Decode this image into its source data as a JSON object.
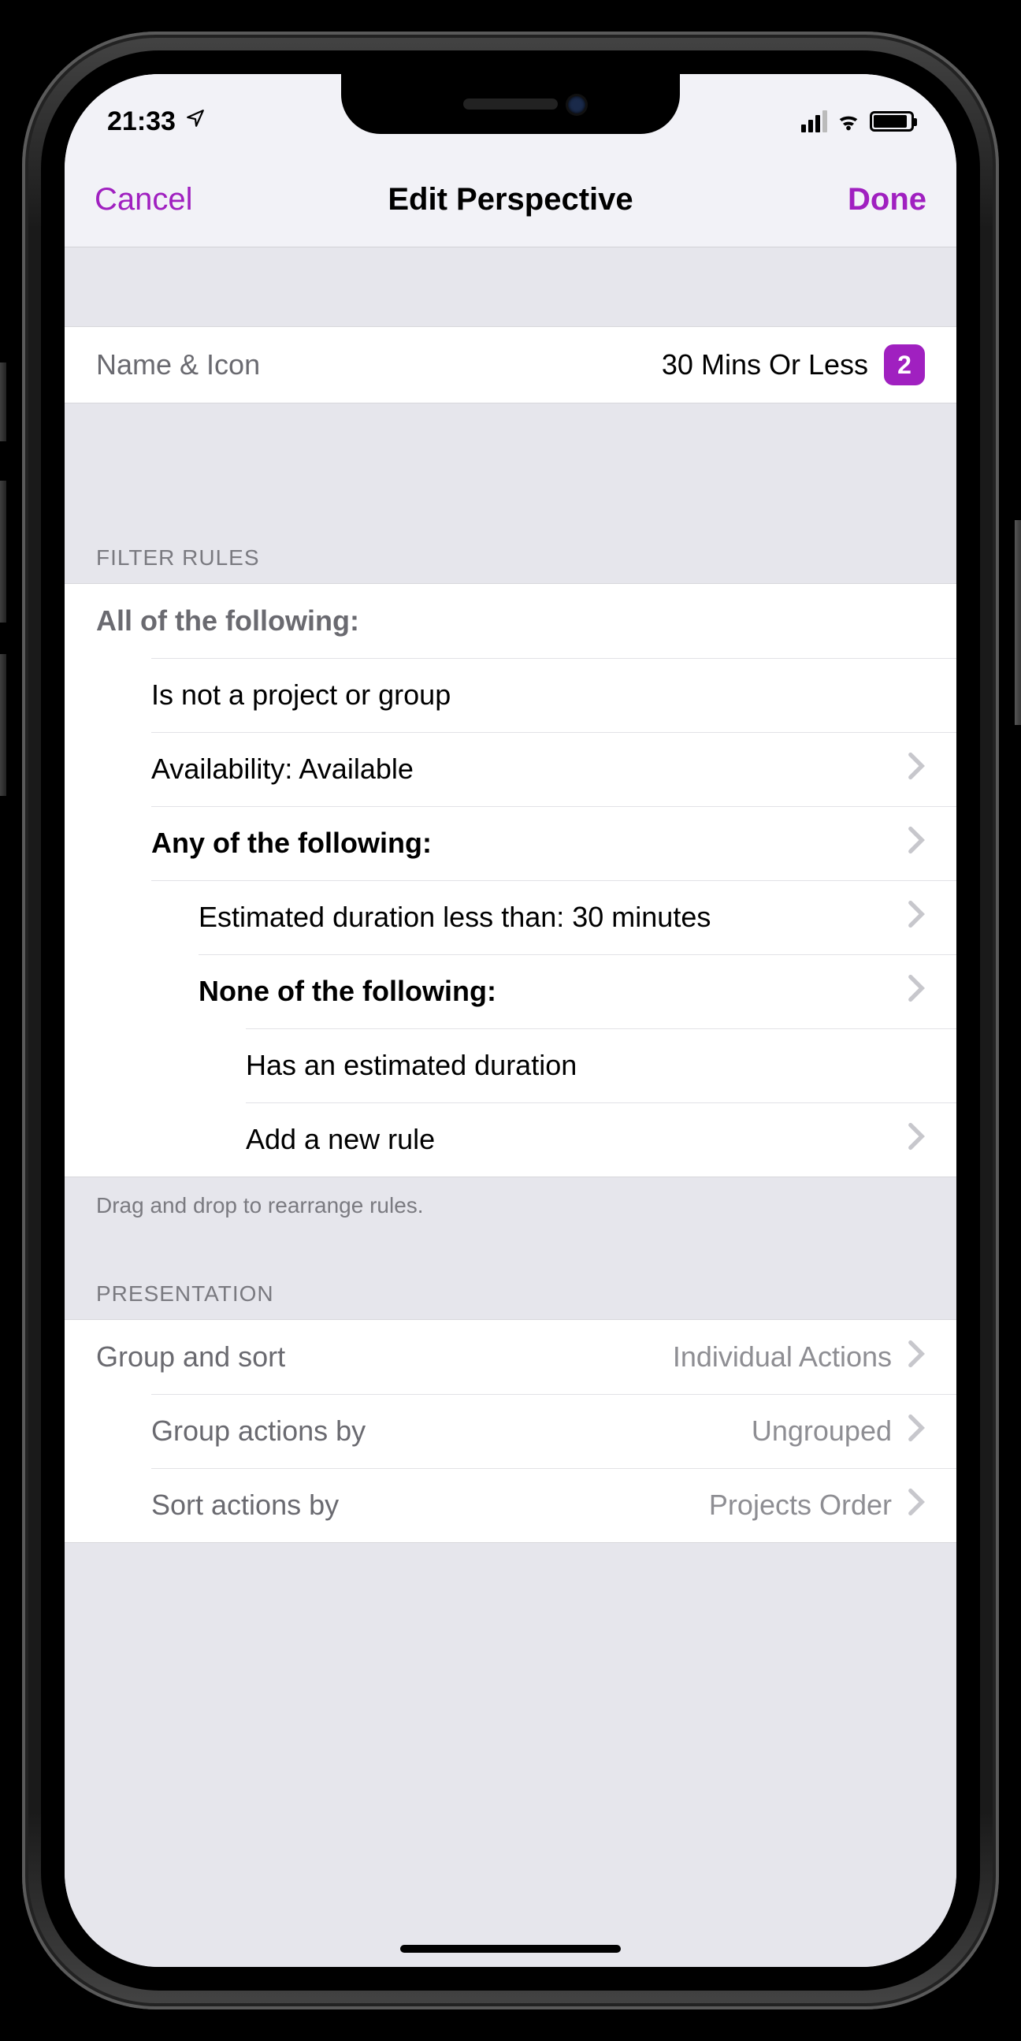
{
  "status": {
    "time": "21:33"
  },
  "nav": {
    "cancel": "Cancel",
    "title": "Edit Perspective",
    "done": "Done"
  },
  "name_row": {
    "label": "Name & Icon",
    "value": "30 Mins Or Less",
    "badge": "2"
  },
  "filter": {
    "section": "FILTER RULES",
    "root": "All of the following:",
    "r1": "Is not a project or group",
    "r2": "Availability: Available",
    "any": "Any of the following:",
    "dur": "Estimated duration less than: 30 minutes",
    "none": "None of the following:",
    "has": "Has an estimated duration",
    "add": "Add a new rule",
    "footer": "Drag and drop to rearrange rules."
  },
  "presentation": {
    "section": "PRESENTATION",
    "group_sort": {
      "label": "Group and sort",
      "value": "Individual Actions"
    },
    "group_by": {
      "label": "Group actions by",
      "value": "Ungrouped"
    },
    "sort_by": {
      "label": "Sort actions by",
      "value": "Projects Order"
    }
  }
}
